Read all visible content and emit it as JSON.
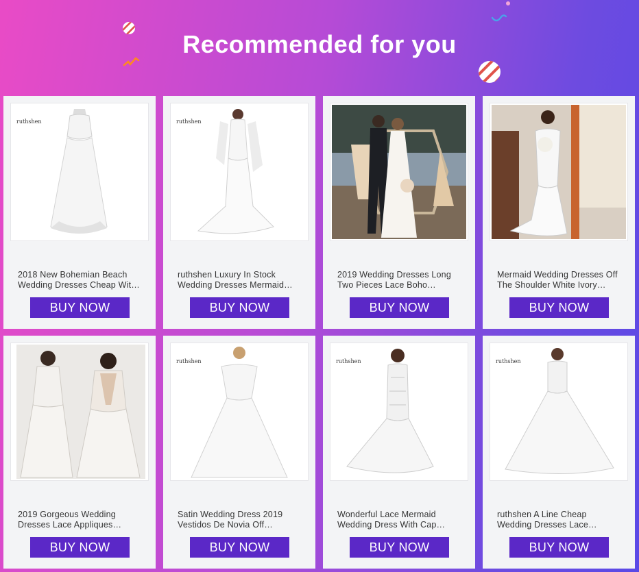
{
  "header": {
    "title": "Recommended for you"
  },
  "products": [
    {
      "brand": "ruthshen",
      "name_line1": "2018 New Bohemian Beach",
      "name_line2": "Wedding Dresses Cheap Wit…",
      "button": "BUY NOW",
      "photo": "white-empire-gown-on-mannequin"
    },
    {
      "brand": "ruthshen",
      "name_line1": "ruthshen Luxury In Stock",
      "name_line2": "Wedding Dresses Mermaid…",
      "button": "BUY NOW",
      "photo": "mermaid-gown-with-cape"
    },
    {
      "brand": "",
      "name_line1": "2019 Wedding Dresses Long",
      "name_line2": "Two Pieces Lace Boho…",
      "button": "BUY NOW",
      "photo": "couple-outdoor-boho-wedding"
    },
    {
      "brand": "",
      "name_line1": "Mermaid Wedding Dresses Off",
      "name_line2": "The Shoulder White Ivory…",
      "button": "BUY NOW",
      "photo": "off-shoulder-mermaid-bride-indoor"
    },
    {
      "brand": "",
      "name_line1": "2019 Gorgeous Wedding",
      "name_line2": "Dresses Lace Appliques…",
      "button": "BUY NOW",
      "photo": "lace-long-sleeve-gown-front-back"
    },
    {
      "brand": "ruthshen",
      "name_line1": "Satin Wedding Dress 2019",
      "name_line2": "Vestidos De Novia Off…",
      "button": "BUY NOW",
      "photo": "satin-off-shoulder-ballgown"
    },
    {
      "brand": "ruthshen",
      "name_line1": "Wonderful Lace Mermaid",
      "name_line2": "Wedding Dress With Cap…",
      "button": "BUY NOW",
      "photo": "lace-mermaid-cap-sleeve"
    },
    {
      "brand": "ruthshen",
      "name_line1": "ruthshen A Line Cheap",
      "name_line2": "Wedding Dresses Lace…",
      "button": "BUY NOW",
      "photo": "a-line-lace-gown"
    }
  ],
  "colors": {
    "button": "#5b28c7",
    "card": "#f3f4f6",
    "gradient_start": "#e94bc6",
    "gradient_end": "#5a49e6"
  }
}
